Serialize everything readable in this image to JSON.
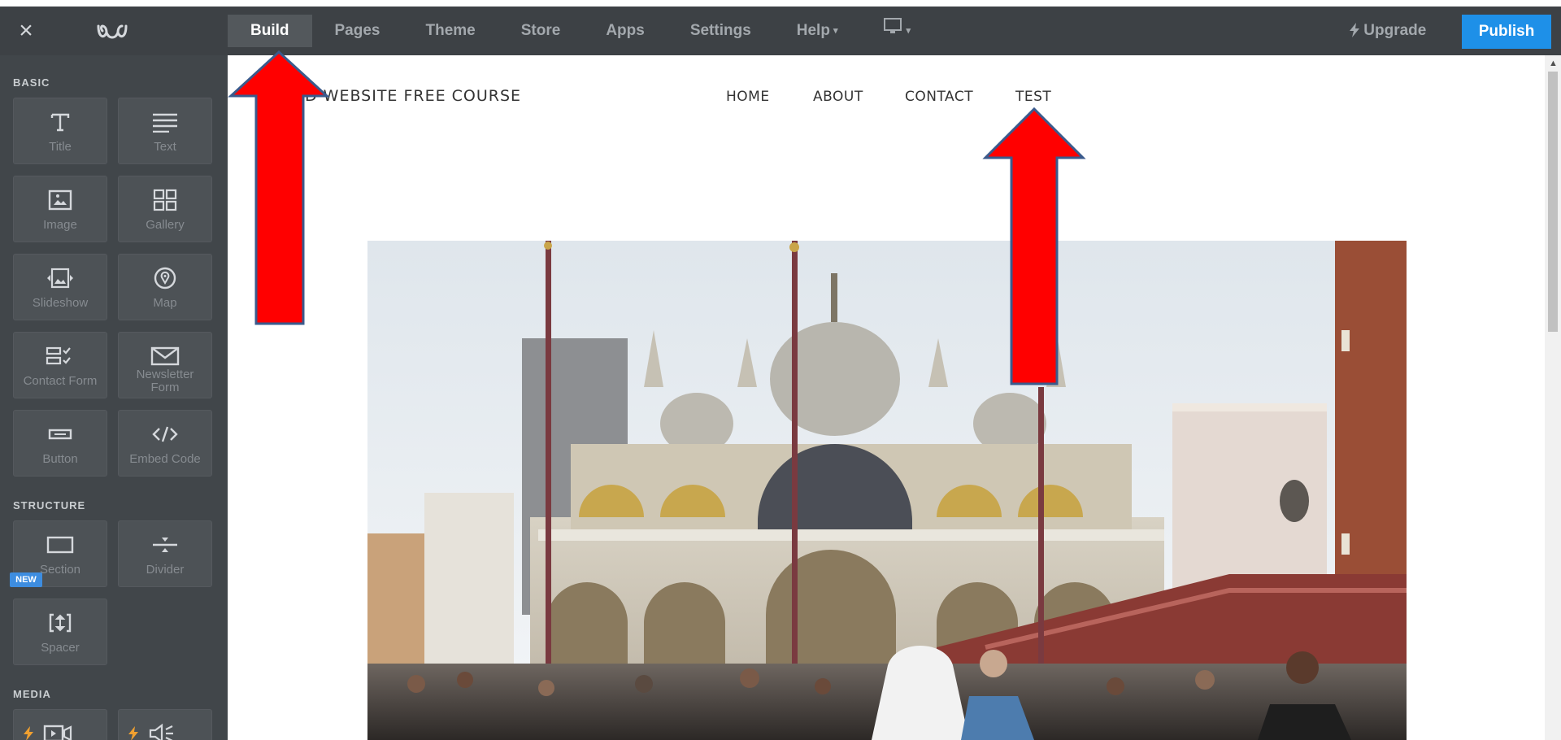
{
  "topbar": {
    "close_label": "×",
    "logo_icon": "weebly-logo-icon",
    "nav": [
      "Build",
      "Pages",
      "Theme",
      "Store",
      "Apps",
      "Settings",
      "Help"
    ],
    "active": "Build",
    "help_caret": "▾",
    "device_caret": "▾",
    "upgrade_label": "Upgrade",
    "publish_label": "Publish",
    "publish_color": "#1e90e8"
  },
  "sidebar": {
    "sections": {
      "basic": "BASIC",
      "structure": "STRUCTURE",
      "media": "MEDIA"
    },
    "new_badge": "NEW",
    "tiles": {
      "title": "Title",
      "text": "Text",
      "image": "Image",
      "gallery": "Gallery",
      "slideshow": "Slideshow",
      "map": "Map",
      "contact_form": "Contact Form",
      "newsletter_form_1": "Newsletter",
      "newsletter_form_2": "Form",
      "button": "Button",
      "embed_code": "Embed Code",
      "section": "Section",
      "divider": "Divider",
      "spacer": "Spacer"
    }
  },
  "site": {
    "title": "D WEBSITE FREE COURSE",
    "nav": [
      "HOME",
      "ABOUT",
      "CONTACT",
      "TEST"
    ]
  },
  "annotations": {
    "arrow_color": "#ff0000",
    "arrow_stroke": "#3a5a8c"
  }
}
